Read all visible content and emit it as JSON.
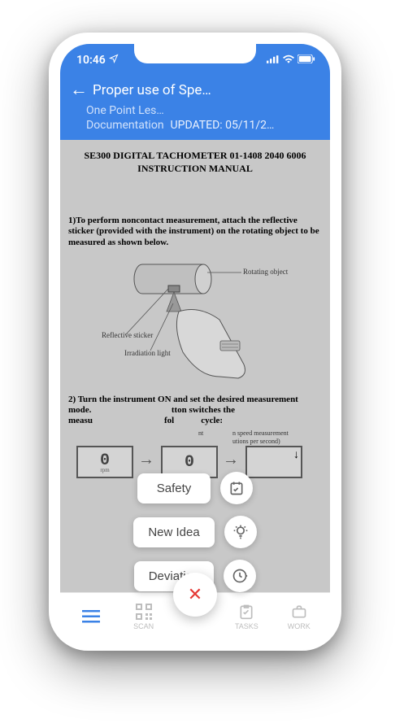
{
  "status": {
    "time": "10:46"
  },
  "header": {
    "title": "Proper use of Spe…",
    "sub1": "One Point Les…",
    "sub2": "Documentation",
    "updated": "UPDATED: 05/11/2…"
  },
  "doc": {
    "title_line1": "SE300 DIGITAL TACHOMETER 01-1408 2040 6006",
    "title_line2": "INSTRUCTION MANUAL",
    "step1": "1)To perform noncontact measurement, attach the reflective sticker (provided with the instrument) on the rotating object to be measured as shown below.",
    "diagram_labels": {
      "rotating": "Rotating object",
      "reflective": "Reflective sticker",
      "irradiation": "Irradiation light"
    },
    "step2_a": "2) Turn the instrument ON and set the desired measurement mode.",
    "step2_b": "tton switches the",
    "step2_c": "cycle:",
    "mode_labels": {
      "left": "nt",
      "mid1": "n speed measurement",
      "mid2": "utions per second)",
      "rpm": "rpm"
    }
  },
  "fab": {
    "safety": "Safety",
    "newidea": "New Idea",
    "deviation": "Deviation"
  },
  "nav": {
    "scan": "SCAN",
    "tasks": "TASKS",
    "work": "WORK"
  }
}
